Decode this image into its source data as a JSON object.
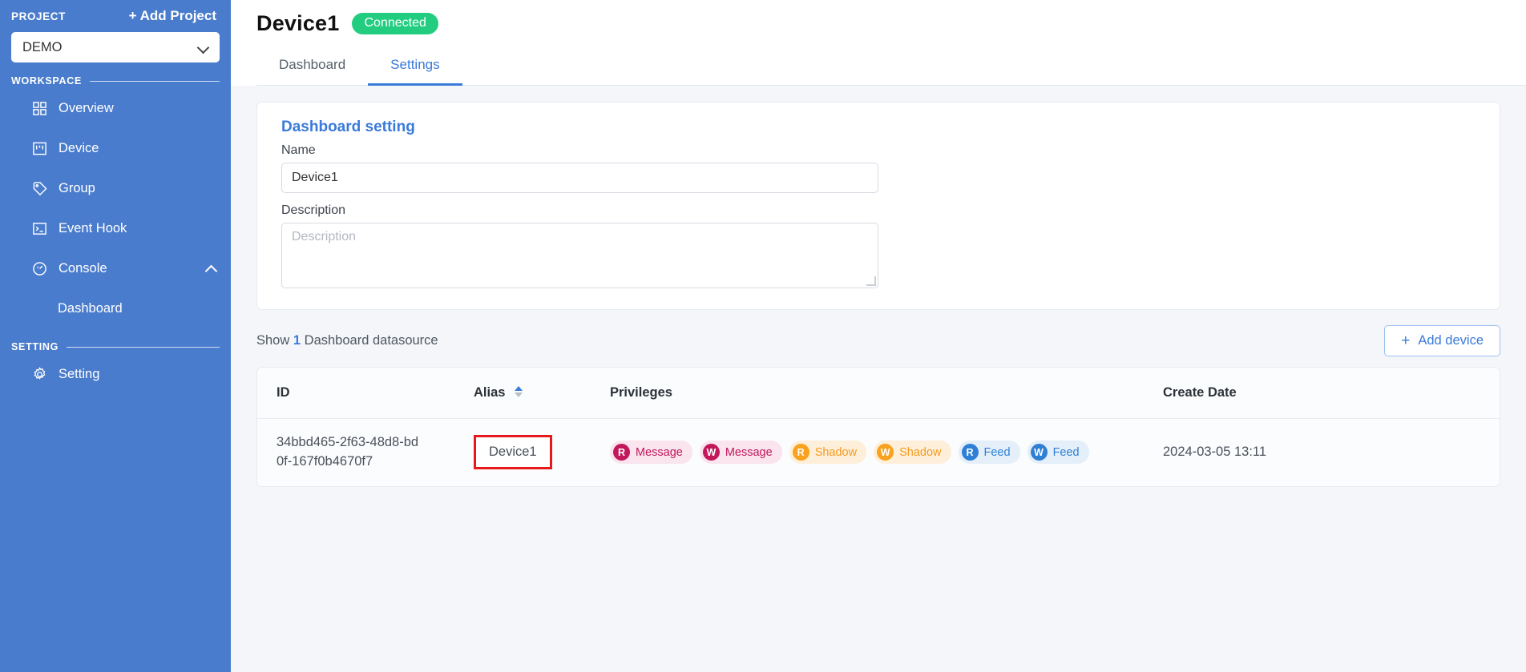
{
  "sidebar": {
    "project_label": "PROJECT",
    "add_project_label": "+ Add Project",
    "project_selected": "DEMO",
    "workspace_label": "WORKSPACE",
    "setting_label": "SETTING",
    "workspace_items": [
      {
        "label": "Overview",
        "icon": "grid-icon"
      },
      {
        "label": "Device",
        "icon": "device-icon"
      },
      {
        "label": "Group",
        "icon": "tag-icon"
      },
      {
        "label": "Event Hook",
        "icon": "terminal-icon"
      },
      {
        "label": "Console",
        "icon": "gauge-icon",
        "expanded": true
      }
    ],
    "console_children": [
      {
        "label": "Dashboard"
      }
    ],
    "setting_items": [
      {
        "label": "Setting",
        "icon": "gear-icon"
      }
    ]
  },
  "header": {
    "device_name": "Device1",
    "status_badge": "Connected",
    "tabs": [
      {
        "label": "Dashboard",
        "active": false
      },
      {
        "label": "Settings",
        "active": true
      }
    ]
  },
  "dashboard_setting": {
    "card_title": "Dashboard setting",
    "name_label": "Name",
    "name_value": "Device1",
    "description_label": "Description",
    "description_placeholder": "Description"
  },
  "datasource": {
    "show_prefix": "Show",
    "count": "1",
    "show_suffix": "Dashboard datasource",
    "add_device_label": "Add device",
    "add_device_plus": "+",
    "columns": [
      "ID",
      "Alias",
      "Privileges",
      "Create Date"
    ],
    "rows": [
      {
        "id": "34bbd465-2f63-48d8-bd0f-167f0b4670f7",
        "alias": "Device1",
        "privileges": [
          {
            "mode": "R",
            "name": "Message",
            "kind": "msg"
          },
          {
            "mode": "W",
            "name": "Message",
            "kind": "msg"
          },
          {
            "mode": "R",
            "name": "Shadow",
            "kind": "shd"
          },
          {
            "mode": "W",
            "name": "Shadow",
            "kind": "shd"
          },
          {
            "mode": "R",
            "name": "Feed",
            "kind": "fed"
          },
          {
            "mode": "W",
            "name": "Feed",
            "kind": "fed"
          }
        ],
        "create_date": "2024-03-05 13:11"
      }
    ]
  },
  "colors": {
    "sidebar_blue": "#4a7ccd",
    "accent_blue": "#3a7ad9",
    "connected_green": "#23cd80",
    "message_pink": "#c2185b",
    "shadow_orange": "#f8a21d",
    "feed_blue": "#2f80d5",
    "highlight_red": "#e8191d"
  }
}
